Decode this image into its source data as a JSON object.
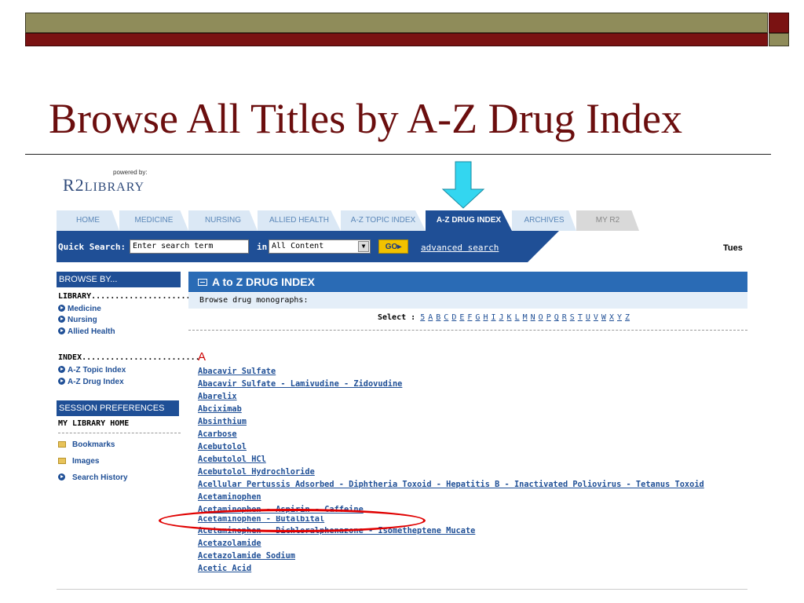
{
  "slide": {
    "title": "Browse All Titles by A-Z Drug Index"
  },
  "logo": {
    "powered_by": "powered by:",
    "name_prefix": "R2",
    "name_suffix": "LIBRARY"
  },
  "tabs": [
    {
      "label": "HOME"
    },
    {
      "label": "MEDICINE"
    },
    {
      "label": "NURSING"
    },
    {
      "label": "ALLIED HEALTH"
    },
    {
      "label": "A-Z TOPIC INDEX"
    },
    {
      "label": "A-Z DRUG INDEX",
      "active": true
    },
    {
      "label": "ARCHIVES"
    },
    {
      "label": "MY R2"
    }
  ],
  "search": {
    "label": "Quick Search:",
    "placeholder": "Enter search term",
    "in_label": "in",
    "scope": "All Content",
    "go_label": "GO",
    "advanced_link": "advanced search",
    "date_partial": "Tues"
  },
  "sidebar": {
    "browse_by": "BROWSE BY...",
    "library_label": "LIBRARY.....................",
    "library_links": [
      "Medicine",
      "Nursing",
      "Allied Health"
    ],
    "index_label": "INDEX.........................",
    "index_links": [
      "A-Z Topic Index",
      "A-Z Drug Index"
    ],
    "session_prefs": "SESSION PREFERENCES",
    "my_library_home": "MY LIBRARY HOME",
    "folder_links": [
      "Bookmarks",
      "Images"
    ],
    "search_history": "Search History"
  },
  "main": {
    "header": "A to Z DRUG INDEX",
    "browse_text": "Browse drug monographs:",
    "select_label": "Select :",
    "letters": [
      "5",
      "A",
      "B",
      "C",
      "D",
      "E",
      "F",
      "G",
      "H",
      "I",
      "J",
      "K",
      "L",
      "M",
      "N",
      "O",
      "P",
      "Q",
      "R",
      "S",
      "T",
      "U",
      "V",
      "W",
      "X",
      "Y",
      "Z"
    ],
    "current_letter": "A",
    "drugs": [
      "Abacavir Sulfate",
      "Abacavir Sulfate - Lamivudine - Zidovudine",
      "Abarelix",
      "Abciximab",
      "Absinthium",
      "Acarbose",
      "Acebutolol",
      "Acebutolol HCl",
      "Acebutolol Hydrochloride",
      "Acellular Pertussis Adsorbed - Diphtheria Toxoid - Hepatitis B - Inactivated Poliovirus - Tetanus Toxoid",
      "Acetaminophen",
      "Acetaminophen - Aspirin - Caffeine",
      "Acetaminophen - Butalbital",
      "Acetaminophen - Dichloralphenazone - Isometheptene Mucate",
      "Acetazolamide",
      "Acetazolamide Sodium",
      "Acetic Acid"
    ]
  },
  "colors": {
    "nav_blue": "#1f4f96",
    "slide_title": "#6b0e0e",
    "highlight_ring": "#e00000",
    "pointer_arrow": "#33d6f0"
  }
}
